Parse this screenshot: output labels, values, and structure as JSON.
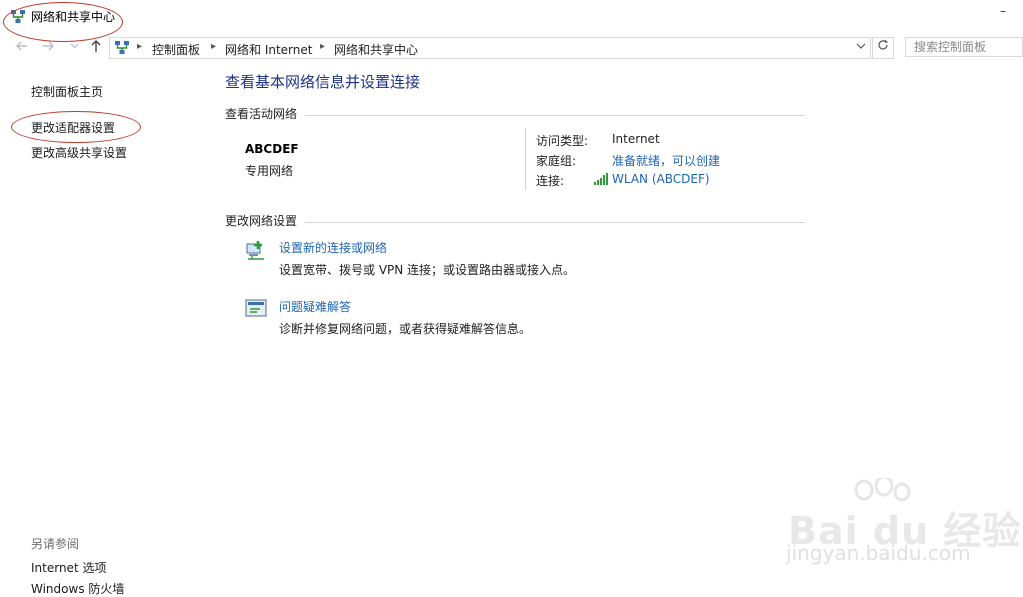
{
  "window": {
    "title": "网络和共享中心",
    "minimize_glyph": "–"
  },
  "address_bar": {
    "back_icon": "arrow-left-icon",
    "forward_icon": "arrow-right-icon",
    "up_icon": "arrow-up-icon",
    "location_icon": "network-icon",
    "breadcrumbs": [
      "控制面板",
      "网络和 Internet",
      "网络和共享中心"
    ],
    "search_placeholder": "搜索控制面板"
  },
  "sidebar": {
    "items": [
      {
        "label": "控制面板主页"
      },
      {
        "label": "更改适配器设置"
      },
      {
        "label": "更改高级共享设置"
      }
    ],
    "see_also_heading": "另请参阅",
    "see_also_items": [
      {
        "label": "Internet 选项"
      },
      {
        "label": "Windows 防火墙"
      }
    ]
  },
  "main": {
    "title": "查看基本网络信息并设置连接",
    "active_section": "查看活动网络",
    "network": {
      "name": "ABCDEF",
      "category": "专用网络",
      "access_type_label": "访问类型:",
      "access_type_value": "Internet",
      "homegroup_label": "家庭组:",
      "homegroup_value": "准备就绪，可以创建",
      "connection_label": "连接:",
      "connection_value": "WLAN (ABCDEF)"
    },
    "change_section": "更改网络设置",
    "tasks": [
      {
        "link": "设置新的连接或网络",
        "desc": "设置宽带、拨号或 VPN 连接；或设置路由器或接入点。",
        "icon": "new-connection-icon"
      },
      {
        "link": "问题疑难解答",
        "desc": "诊断并修复网络问题，或者获得疑难解答信息。",
        "icon": "troubleshoot-icon"
      }
    ]
  },
  "watermark": {
    "brand": "Bai du 经验",
    "url": "jingyan.baidu.com"
  },
  "colors": {
    "title_blue": "#1e3287",
    "link_blue": "#1f64b4",
    "annotation_red": "#c0392b"
  }
}
